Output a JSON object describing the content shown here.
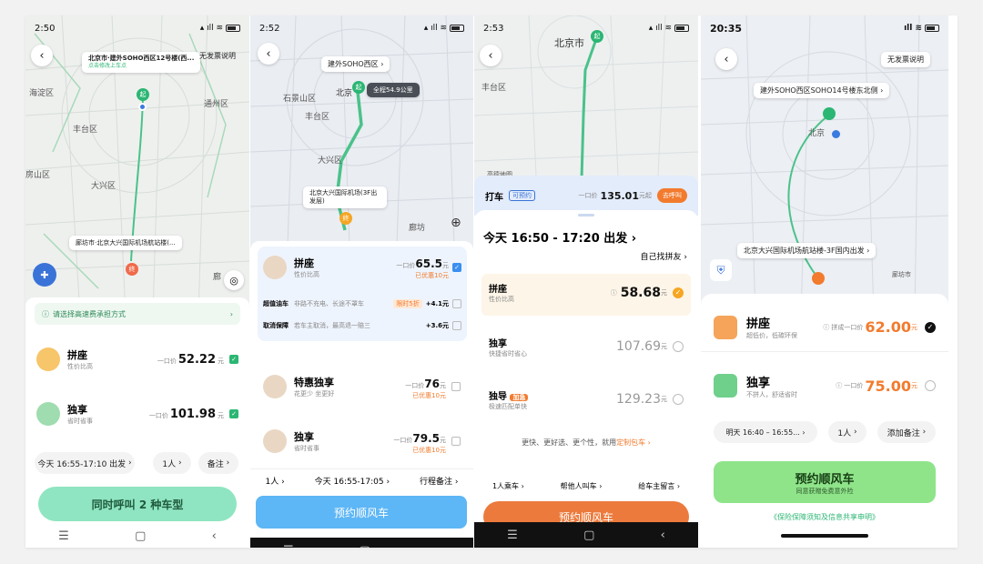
{
  "colors": {
    "green": "#2bb673",
    "orange": "#f27b2e",
    "blue": "#3aa0f0",
    "route": "#4ac28a"
  },
  "s1": {
    "time": "2:50",
    "help": "无发票说明",
    "pickup": "北京市·建外SOHO西区12号楼(西...",
    "pickup_hint": "点击修改上车点",
    "dest": "廊坊市·北京大兴国际机场航站楼(...",
    "map_labels": {
      "haidian": "海淀区",
      "fengtai": "丰台区",
      "tongzhou": "通州区",
      "daxing": "大兴区",
      "fangshan": "房山区",
      "langfang": "廊"
    },
    "notice": "请选择高速费承担方式",
    "options": [
      {
        "name": "拼座",
        "desc": "性价比高",
        "prefix": "一口价",
        "price": "52.22",
        "unit": "元"
      },
      {
        "name": "独享",
        "desc": "省时省事",
        "prefix": "一口价",
        "price": "101.98",
        "unit": "元"
      }
    ],
    "time_pill": "今天 16:55-17:10 出发",
    "people_pill": "1人",
    "note_pill": "备注",
    "cta": "同时呼叫 2 种车型"
  },
  "s2": {
    "time": "2:52",
    "start_chip": "建外SOHO西区",
    "distance_chip": "全程54.9公里",
    "dest_chip": "北京大兴国际机场(3F出发层)",
    "map_labels": {
      "beijing": "北京",
      "shijingshan": "石景山区",
      "fengtai": "丰台区",
      "daxing": "大兴区",
      "langfang": "廊坊"
    },
    "start_tag": "起",
    "end_tag": "终",
    "options": [
      {
        "name": "拼座",
        "desc": "性价比高",
        "prefix": "一口价",
        "price": "65.5",
        "unit": "元",
        "disc": "已优惠10元"
      },
      {
        "name": "特惠独享",
        "desc": "花更少 坐更好",
        "prefix": "一口价",
        "price": "76",
        "unit": "元",
        "disc": "已优惠10元"
      },
      {
        "name": "独享",
        "desc": "省时省事",
        "prefix": "一口价",
        "price": "79.5",
        "unit": "元",
        "disc": "已优惠10元"
      }
    ],
    "addons": [
      {
        "name": "超值油车",
        "desc": "非路不充电、长途不罩车",
        "tag": "限时5折",
        "price": "+4.1元"
      },
      {
        "name": "取消保障",
        "desc": "若车主取消，最高退一赔三",
        "tag": "",
        "price": "+3.6元"
      }
    ],
    "bar": {
      "people": "1人",
      "time": "今天 16:55-17:05",
      "note": "行程备注"
    },
    "cta": "预约顺风车"
  },
  "s3": {
    "time": "2:53",
    "map_labels": {
      "beijing": "北京市",
      "fengtai": "丰台区",
      "source": "高德地图"
    },
    "taxi": {
      "label": "打车",
      "badge": "可预约",
      "prefix": "一口价",
      "price": "135.01",
      "suffix": "元起",
      "btn": "去呼叫"
    },
    "title": "今天 16:50 - 17:20 出发",
    "find": "自己找拼友",
    "options": [
      {
        "name": "拼座",
        "desc": "性价比高",
        "price": "58.68",
        "unit": "元"
      },
      {
        "name": "独享",
        "desc": "快捷省时省心",
        "price": "107.69",
        "unit": "元"
      },
      {
        "name": "独导",
        "tag": "加急",
        "desc": "极速匹配单快",
        "price": "129.23",
        "unit": "元"
      }
    ],
    "more": "更快、更好选、更个性，就用",
    "more_link": "定制包车",
    "bar": {
      "a": "1人乘车",
      "b": "帮他人叫车",
      "c": "给车主留言"
    },
    "cta": "预约顺风车"
  },
  "s4": {
    "time": "20:35",
    "help": "无发票说明",
    "start": "建外SOHO西区SOHO14号楼东北侧",
    "dest": "北京大兴国际机场航站楼-3F国内出发",
    "map_labels": {
      "beijing": "北京",
      "langfang": "廊坊市"
    },
    "options": [
      {
        "name": "拼座",
        "desc": "超低价，低碳环保",
        "prefix": "拼成一口价",
        "price": "62.00",
        "unit": "元"
      },
      {
        "name": "独享",
        "desc": "不拼人，舒适省时",
        "prefix": "一口价",
        "price": "75.00",
        "unit": "元"
      }
    ],
    "time_pill": "明天 16:40 – 16:55...",
    "people_pill": "1人",
    "note_pill": "添加备注",
    "cta": "预约顺风车",
    "cta_sub": "同意获赠免费意外险",
    "footer": "《保险保障须知及信息共享申明》"
  }
}
